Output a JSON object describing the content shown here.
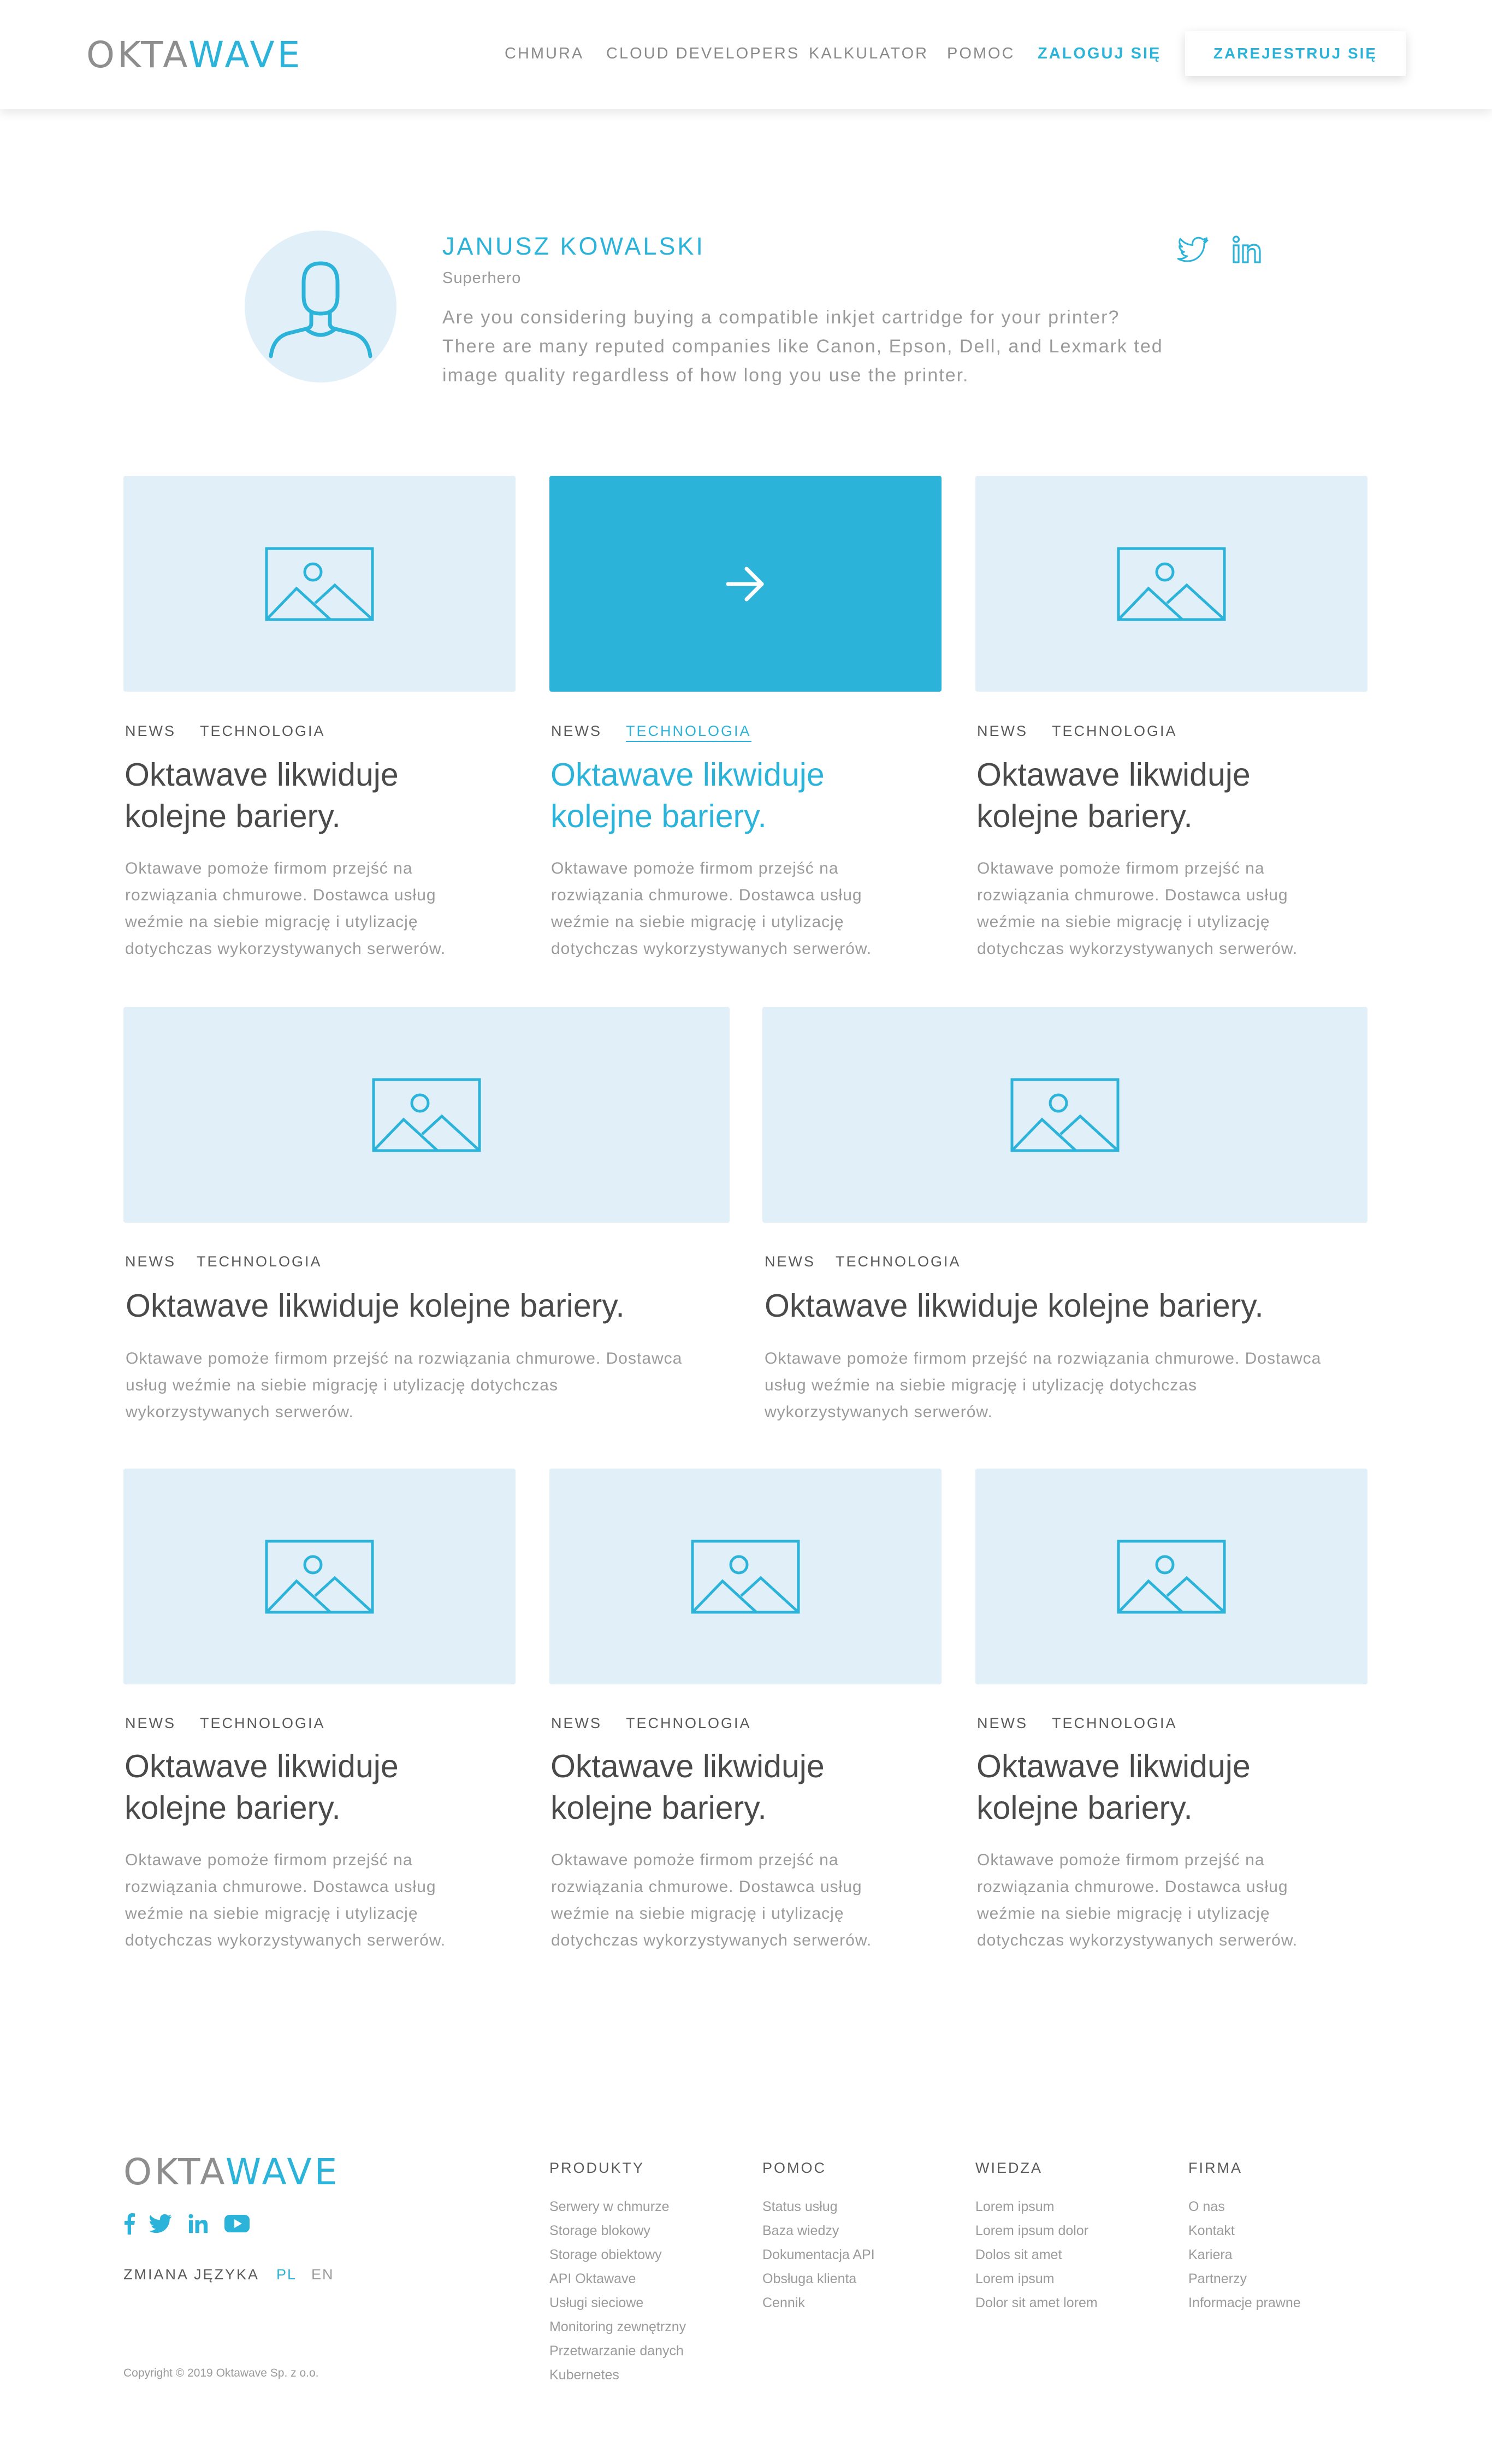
{
  "colors": {
    "accent": "#2cb3d9",
    "placeholder": "#e1eff8",
    "text": "#4a4a4a",
    "muted": "#9b9b9b"
  },
  "header": {
    "logo_part1": "OKTA",
    "logo_part2": "WAVE",
    "nav": [
      "CHMURA",
      "CLOUD DEVELOPERS",
      "KALKULATOR",
      "POMOC"
    ],
    "login": "ZALOGUJ SIĘ",
    "register": "ZAREJESTRUJ SIĘ"
  },
  "author": {
    "name": "JANUSZ KOWALSKI",
    "role": "Superhero",
    "bio_lines": [
      "Are you considering buying a compatible inkjet cartridge for your printer?",
      "There are many reputed companies like Canon, Epson, Dell, and Lexmark ted",
      "image quality regardless of how long you use the printer."
    ],
    "social_icons": [
      "twitter-icon",
      "linkedin-icon"
    ]
  },
  "cards": [
    {
      "tags": [
        "NEWS",
        "TECHNOLOGIA"
      ],
      "title_lines": [
        "Oktawave likwiduje",
        "kolejne bariery."
      ],
      "excerpt_lines": [
        "Oktawave pomoże firmom przejść na",
        "rozwiązania chmurowe. Dostawca usług",
        "weźmie na siebie migrację i utylizację",
        "dotychczas wykorzystywanych serwerów."
      ]
    },
    {
      "tags": [
        "NEWS",
        "TECHNOLOGIA"
      ],
      "title_lines": [
        "Oktawave likwiduje",
        "kolejne bariery."
      ],
      "excerpt_lines": [
        "Oktawave pomoże firmom przejść na",
        "rozwiązania chmurowe. Dostawca usług",
        "weźmie na siebie migrację i utylizację",
        "dotychczas wykorzystywanych serwerów."
      ],
      "hovered": true
    },
    {
      "tags": [
        "NEWS",
        "TECHNOLOGIA"
      ],
      "title_lines": [
        "Oktawave likwiduje",
        "kolejne bariery."
      ],
      "excerpt_lines": [
        "Oktawave pomoże firmom przejść na",
        "rozwiązania chmurowe. Dostawca usług",
        "weźmie na siebie migrację i utylizację",
        "dotychczas wykorzystywanych serwerów."
      ]
    },
    {
      "tags": [
        "NEWS",
        "TECHNOLOGIA"
      ],
      "title_lines": [
        "Oktawave likwiduje kolejne bariery."
      ],
      "excerpt_lines": [
        "Oktawave pomoże firmom przejść na rozwiązania chmurowe. Dostawca",
        "usług weźmie na siebie migrację i utylizację dotychczas",
        "wykorzystywanych serwerów."
      ]
    },
    {
      "tags": [
        "NEWS",
        "TECHNOLOGIA"
      ],
      "title_lines": [
        "Oktawave likwiduje kolejne bariery."
      ],
      "excerpt_lines": [
        "Oktawave pomoże firmom przejść na rozwiązania chmurowe. Dostawca",
        "usług weźmie na siebie migrację i utylizację dotychczas",
        "wykorzystywanych serwerów."
      ]
    },
    {
      "tags": [
        "NEWS",
        "TECHNOLOGIA"
      ],
      "title_lines": [
        "Oktawave likwiduje",
        "kolejne bariery."
      ],
      "excerpt_lines": [
        "Oktawave pomoże firmom przejść na",
        "rozwiązania chmurowe. Dostawca usług",
        "weźmie na siebie migrację i utylizację",
        "dotychczas wykorzystywanych serwerów."
      ]
    },
    {
      "tags": [
        "NEWS",
        "TECHNOLOGIA"
      ],
      "title_lines": [
        "Oktawave likwiduje",
        "kolejne bariery."
      ],
      "excerpt_lines": [
        "Oktawave pomoże firmom przejść na",
        "rozwiązania chmurowe. Dostawca usług",
        "weźmie na siebie migrację i utylizację",
        "dotychczas wykorzystywanych serwerów."
      ]
    },
    {
      "tags": [
        "NEWS",
        "TECHNOLOGIA"
      ],
      "title_lines": [
        "Oktawave likwiduje",
        "kolejne bariery."
      ],
      "excerpt_lines": [
        "Oktawave pomoże firmom przejść na",
        "rozwiązania chmurowe. Dostawca usług",
        "weźmie na siebie migrację i utylizację",
        "dotychczas wykorzystywanych serwerów."
      ]
    }
  ],
  "footer": {
    "logo_part1": "OKTA",
    "logo_part2": "WAVE",
    "social_icons": [
      "facebook-icon",
      "twitter-icon",
      "linkedin-icon",
      "youtube-icon"
    ],
    "language_label": "ZMIANA JĘZYKA",
    "languages": [
      "PL",
      "EN"
    ],
    "active_language": "PL",
    "copyright": "Copyright © 2019 Oktawave Sp. z o.o.",
    "columns": [
      {
        "title": "PRODUKTY",
        "links": [
          "Serwery w chmurze",
          "Storage blokowy",
          "Storage obiektowy",
          "API Oktawave",
          "Usługi sieciowe",
          "Monitoring zewnętrzny",
          "Przetwarzanie danych",
          "Kubernetes"
        ]
      },
      {
        "title": "POMOC",
        "links": [
          "Status usług",
          "Baza wiedzy",
          "Dokumentacja API",
          "Obsługa klienta",
          "Cennik"
        ]
      },
      {
        "title": "WIEDZA",
        "links": [
          "Lorem ipsum",
          "Lorem ipsum dolor",
          "Dolos sit amet",
          "Lorem ipsum",
          "Dolor sit amet lorem"
        ]
      },
      {
        "title": "FIRMA",
        "links": [
          "O nas",
          "Kontakt",
          "Kariera",
          "Partnerzy",
          "Informacje prawne"
        ]
      }
    ]
  }
}
